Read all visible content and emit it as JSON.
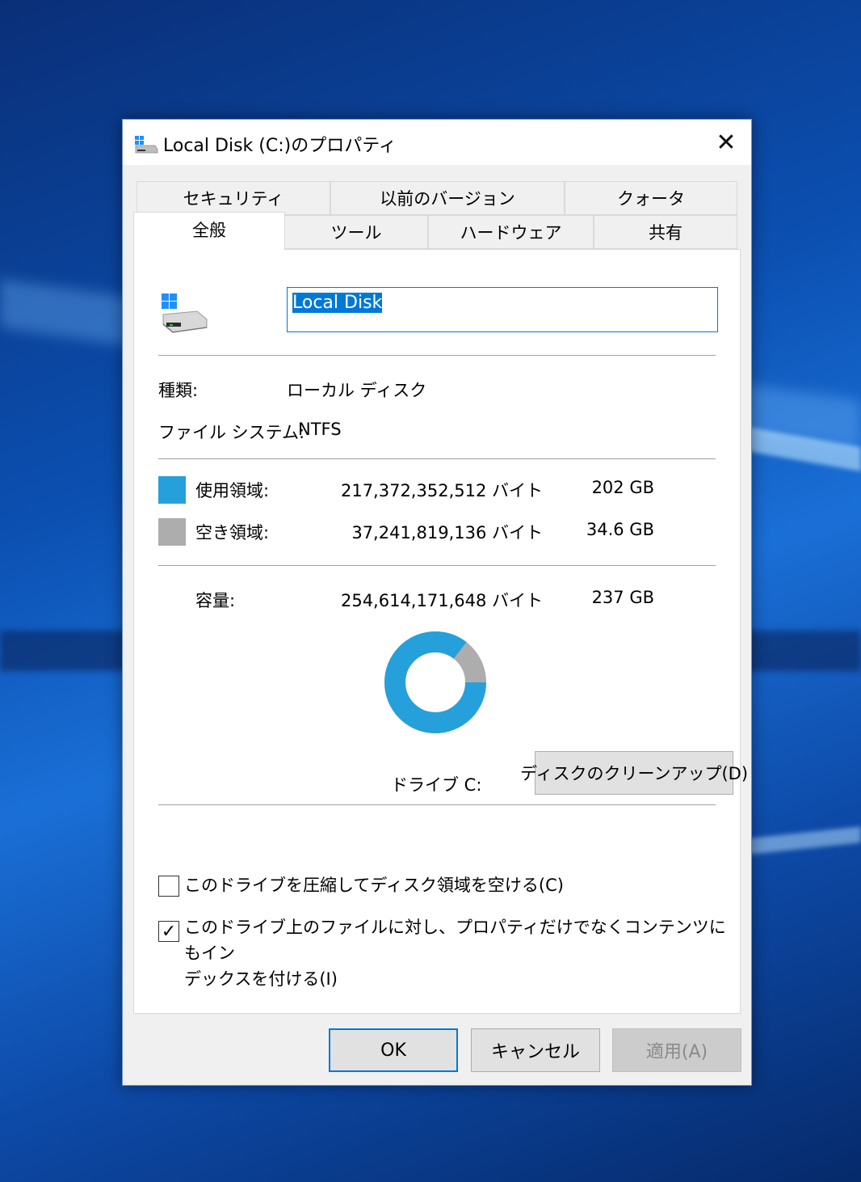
{
  "window": {
    "title": "Local Disk (C:)のプロパティ",
    "close_label": "✕"
  },
  "tabs": {
    "row1": [
      "セキュリティ",
      "以前のバージョン",
      "クォータ"
    ],
    "row2": [
      "全般",
      "ツール",
      "ハードウェア",
      "共有"
    ],
    "active": "全般"
  },
  "general": {
    "name_value": "Local Disk",
    "type_label": "種類:",
    "type_value": "ローカル ディスク",
    "fs_label": "ファイル システム:",
    "fs_value": "NTFS",
    "used_label": "使用領域:",
    "used_bytes": "217,372,352,512 バイト",
    "used_size": "202 GB",
    "free_label": "空き領域:",
    "free_bytes": "37,241,819,136 バイト",
    "free_size": "34.6 GB",
    "capacity_label": "容量:",
    "capacity_bytes": "254,614,171,648 バイト",
    "capacity_size": "237 GB",
    "drive_label": "ドライブ C:",
    "cleanup_button": "ディスクのクリーンアップ(D)",
    "compress_label": "このドライブを圧縮してディスク領域を空ける(C)",
    "compress_checked": false,
    "index_label_line1": "このドライブ上のファイルに対し、プロパティだけでなくコンテンツにもイン",
    "index_label_line2": "デックスを付ける(I)",
    "index_checked": true,
    "used_color": "#26a0da",
    "free_color": "#adadad",
    "used_fraction": 0.8537
  },
  "buttons": {
    "ok": "OK",
    "cancel": "キャンセル",
    "apply": "適用(A)"
  }
}
